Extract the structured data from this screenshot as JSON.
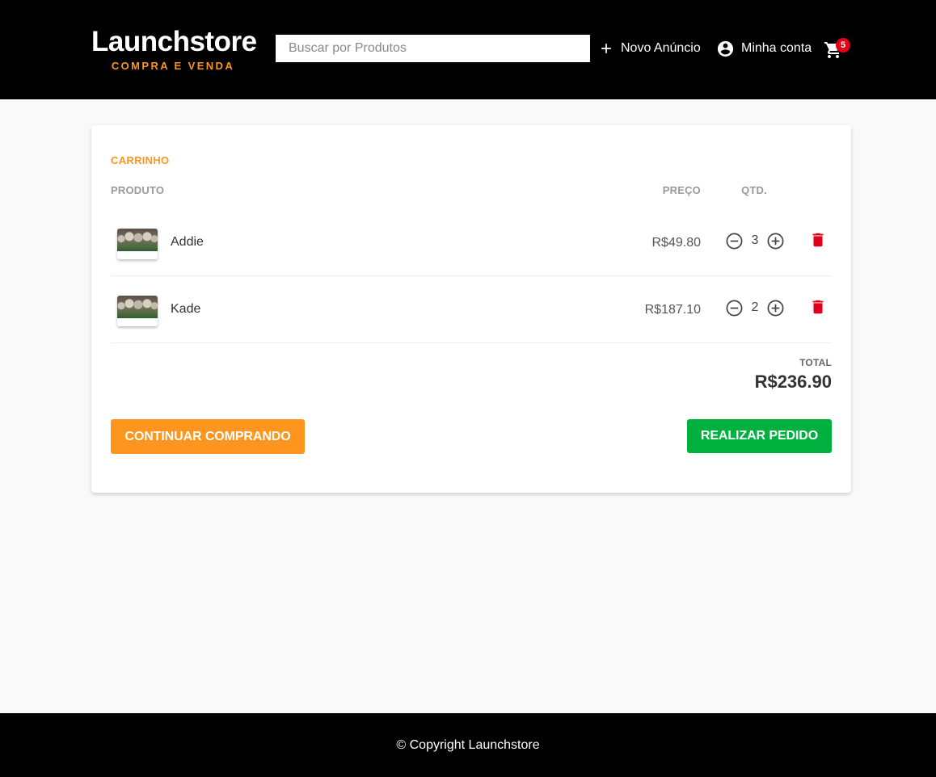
{
  "header": {
    "logo_title": "Launchstore",
    "logo_subtitle": "COMPRA E VENDA",
    "search_placeholder": "Buscar por Produtos",
    "new_listing_label": "Novo Anúncio",
    "account_label": "Minha conta",
    "cart_count": "5",
    "icons": {
      "new_listing": "plus-icon",
      "account": "account-circle-icon",
      "cart": "shopping-cart-icon"
    }
  },
  "cart": {
    "title": "CARRINHO",
    "columns": {
      "product": "PRODUTO",
      "price": "PREÇO",
      "qty": "QTD."
    },
    "items": [
      {
        "name": "Addie",
        "price": "R$49.80",
        "quantity": "3"
      },
      {
        "name": "Kade",
        "price": "R$187.10",
        "quantity": "2"
      }
    ],
    "total_label": "TOTAL",
    "total_value": "R$236.90",
    "continue_button": "CONTINUAR COMPRANDO",
    "order_button": "REALIZAR PEDIDO"
  },
  "footer": {
    "copyright": "© Copyright Launchstore"
  },
  "colors": {
    "accent_orange": "#fd951f",
    "order_green": "#00b13f",
    "delete_red": "#e0001a",
    "header_bg": "#000000"
  }
}
